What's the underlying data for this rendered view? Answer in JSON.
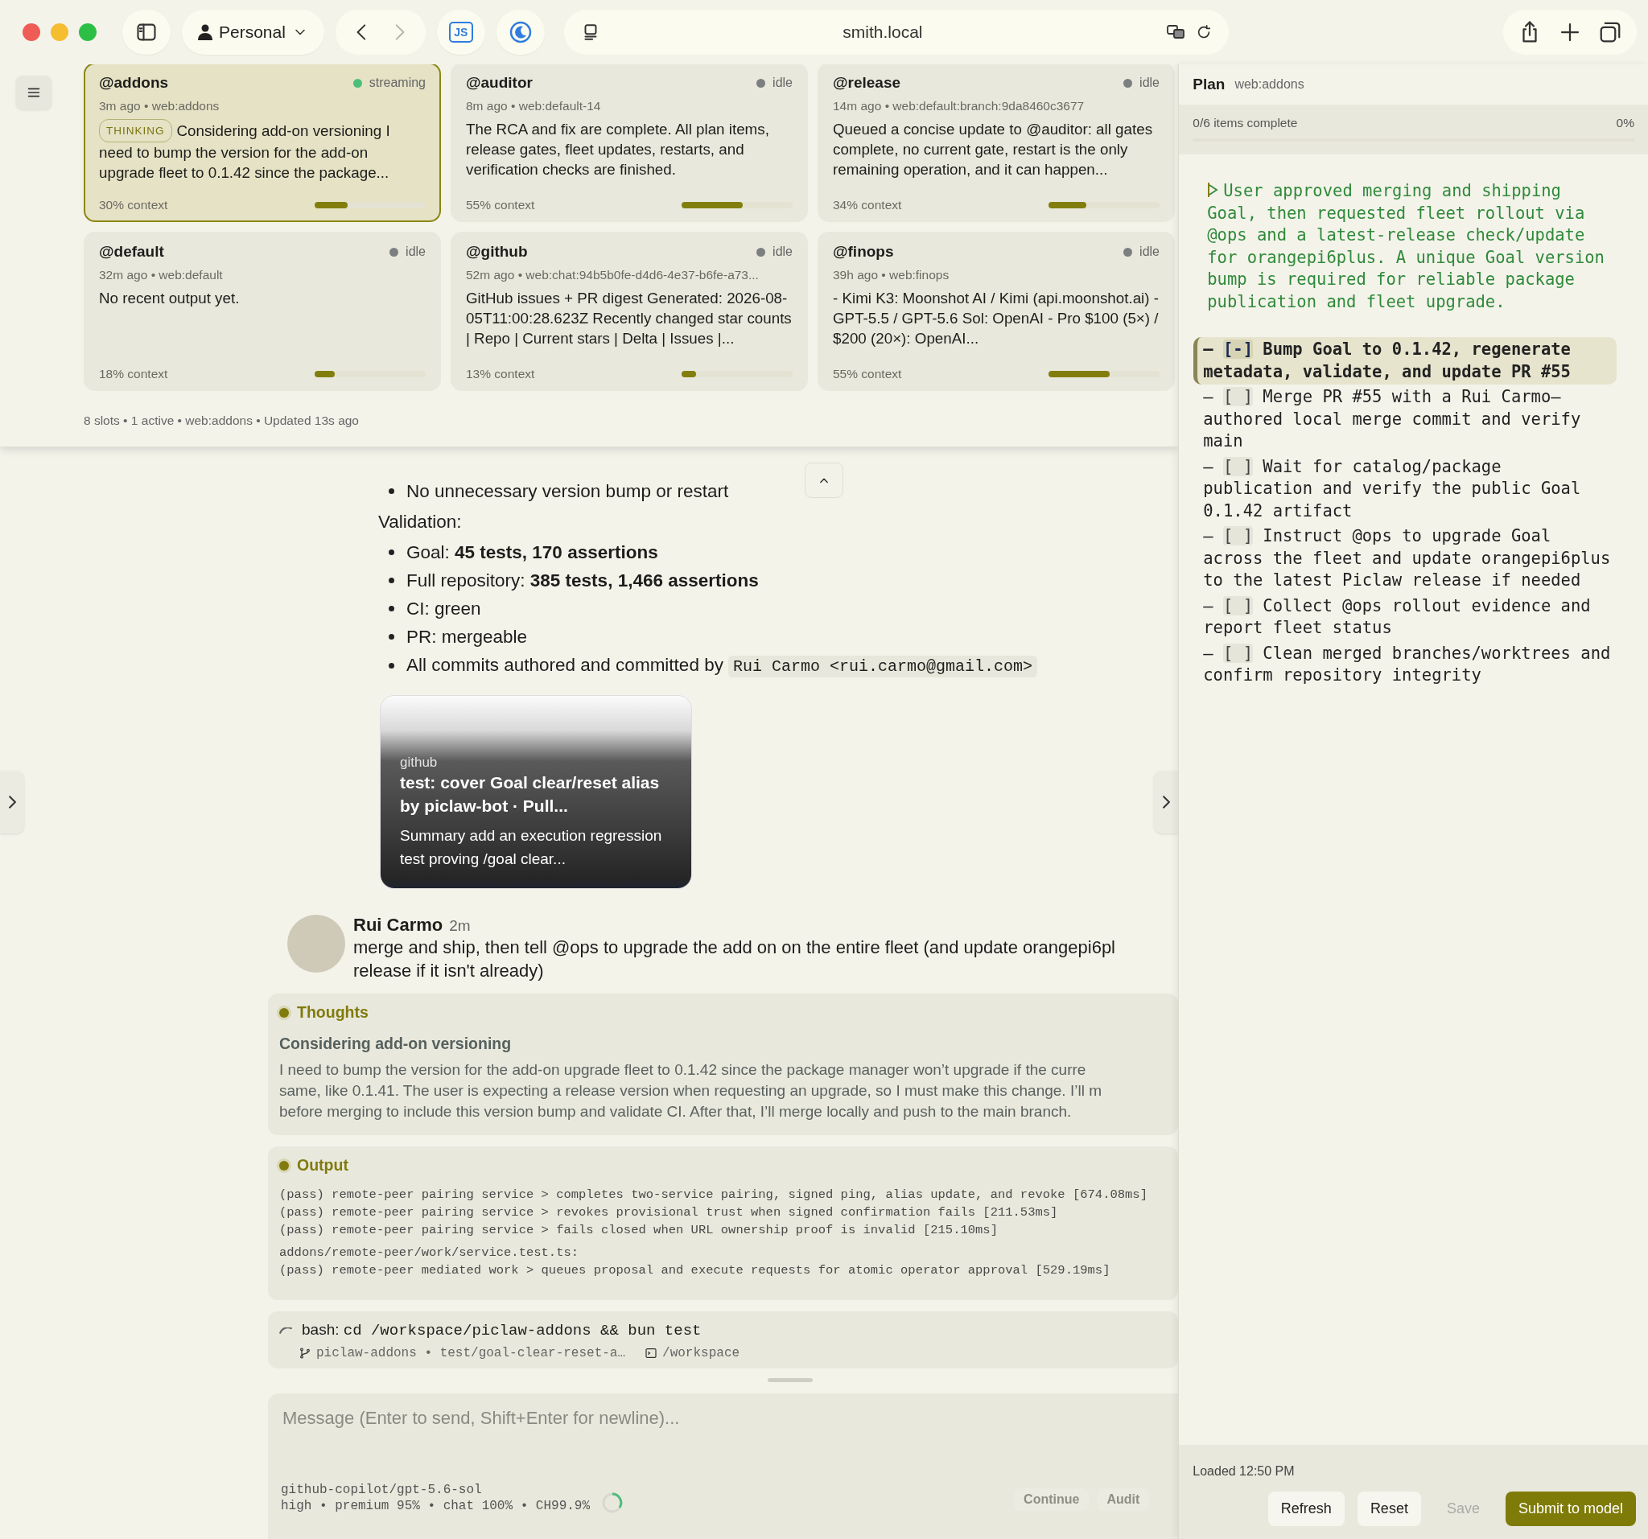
{
  "toolbar": {
    "profile": "Personal",
    "address": "smith.local",
    "forward_disabled": true,
    "extension_label": "JS"
  },
  "sessions": {
    "cards": [
      {
        "name": "@addons",
        "status": "streaming",
        "color": "#4cbf7a",
        "meta": "3m ago • web:addons",
        "badge": "THINKING",
        "summary": "Considering add-on versioning I need to bump the version for the add-on upgrade fleet to 0.1.42 since the package...",
        "context": "30% context",
        "level": 0.3,
        "selected": true
      },
      {
        "name": "@auditor",
        "status": "idle",
        "color": "#7b7f80",
        "meta": "8m ago • web:default-14",
        "summary": "The RCA and fix are complete. All plan items, release gates, fleet updates, restarts, and verification checks are finished.",
        "context": "55% context",
        "level": 0.55,
        "selected": false
      },
      {
        "name": "@release",
        "status": "idle",
        "color": "#7b7f80",
        "meta": "14m ago • web:default:branch:9da8460c3677",
        "summary": "Queued a concise update to @auditor: all gates complete, no current gate, restart is the only remaining operation, and it can happen...",
        "context": "34% context",
        "level": 0.34,
        "selected": false
      },
      {
        "name": "@default",
        "status": "idle",
        "color": "#7b7f80",
        "meta": "32m ago • web:default",
        "summary": "No recent output yet.",
        "context": "18% context",
        "level": 0.18,
        "selected": false
      },
      {
        "name": "@github",
        "status": "idle",
        "color": "#7b7f80",
        "meta": "52m ago • web:chat:94b5b0fe-d4d6-4e37-b6fe-a73...",
        "summary": "GitHub issues + PR digest Generated: 2026-08-05T11:00:28.623Z Recently changed star counts | Repo | Current stars | Delta | Issues |...",
        "context": "13% context",
        "level": 0.13,
        "selected": false
      },
      {
        "name": "@finops",
        "status": "idle",
        "color": "#7b7f80",
        "meta": "39h ago • web:finops",
        "summary": "- Kimi K3: Moonshot AI / Kimi (api.moonshot.ai) - GPT-5.5 / GPT-5.6 Sol: OpenAI - Pro $100 (5×) / $200 (20×): OpenAI...",
        "context": "55% context",
        "level": 0.55,
        "selected": false
      }
    ],
    "footer": "8 slots • 1 active • web:addons • Updated 13s ago"
  },
  "chat": {
    "bullets_top": [
      "No unnecessary version bump or restart"
    ],
    "heading": "Validation:",
    "bullets": [
      {
        "text": "Goal: **45 tests, 170 assertions**"
      },
      {
        "text": "Full repository: **385 tests, 1,466 assertions**"
      },
      {
        "text": "CI: green"
      },
      {
        "text": "PR: mergeable"
      },
      {
        "text": "All commits authored and committed by",
        "code": "Rui Carmo <rui.carmo@gmail.com>"
      }
    ],
    "link_preview": {
      "source": "github",
      "title": "test: cover Goal clear/reset alias by piclaw-bot · Pull...",
      "summary": "Summary add an execution regression test proving /goal clear..."
    },
    "message": {
      "author": "Rui Carmo",
      "time": "2m",
      "lines": [
        "merge and ship, then tell @ops to upgrade the add on on the entire fleet (and update orangepi6pl",
        "release if it isn't already)"
      ]
    },
    "thoughts": {
      "label": "Thoughts",
      "title": "Considering add-on versioning",
      "lines": [
        "I need to bump the version for the add-on upgrade fleet to 0.1.42 since the package manager won’t upgrade if the curre",
        "same, like 0.1.41. The user is expecting a release version when requesting an upgrade, so I must make this change. I’ll m",
        "before merging to include this version bump and validate CI. After that, I’ll merge locally and push to the main branch."
      ]
    },
    "output": {
      "label": "Output",
      "lines": [
        "(pass) remote-peer pairing service > completes two-service pairing, signed ping, alias update, and revoke [674.08ms]",
        "(pass) remote-peer pairing service > revokes provisional trust when signed confirmation fails [211.53ms]",
        "(pass) remote-peer pairing service > fails closed when URL ownership proof is invalid [215.10ms]",
        "addons/remote-peer/work/service.test.ts:",
        "(pass) remote-peer mediated work > queues proposal and execute requests for atomic operator approval [529.19ms]"
      ]
    },
    "tool_call": {
      "prefix": "bash:",
      "command": "cd /workspace/piclaw-addons && bun test",
      "branch": "piclaw-addons • test/goal-clear-reset-a…",
      "cwd": "/workspace"
    }
  },
  "composer": {
    "placeholder": "Message (Enter to send, Shift+Enter for newline)...",
    "model": "github-copilot/gpt-5.6-sol",
    "stats": "high • premium 95% • chat 100% • CH99.9%",
    "buttons": [
      {
        "label": "Continue",
        "disabled": true
      },
      {
        "label": "Audit",
        "disabled": true
      }
    ]
  },
  "plan": {
    "title": "Plan",
    "scope": "web:addons",
    "progress": "0/6 items complete",
    "percent": "0%",
    "level": 0,
    "note": "User approved merging and shipping Goal, then requested fleet rollout via @ops and a latest-release check/update for orangepi6plus. A unique Goal version bump is required for reliable package publication and fleet upgrade.",
    "items": [
      {
        "dash": "–",
        "box": "[-]",
        "text": "Bump Goal to 0.1.42, regenerate metadata, validate, and update PR #55",
        "current": true
      },
      {
        "dash": "–",
        "box": "[ ]",
        "text": "Merge PR #55 with a Rui Carmo–authored local merge commit and verify main",
        "current": false
      },
      {
        "dash": "–",
        "box": "[ ]",
        "text": "Wait for catalog/package publication and verify the public Goal 0.1.42 artifact",
        "current": false
      },
      {
        "dash": "–",
        "box": "[ ]",
        "text": "Instruct @ops to upgrade Goal across the fleet and update orangepi6plus to the latest Piclaw release if needed",
        "current": false
      },
      {
        "dash": "–",
        "box": "[ ]",
        "text": "Collect @ops rollout evidence and report fleet status",
        "current": false
      },
      {
        "dash": "–",
        "box": "[ ]",
        "text": "Clean merged branches/worktrees and confirm repository integrity",
        "current": false
      }
    ],
    "loaded": "Loaded 12:50 PM",
    "buttons": [
      {
        "label": "Refresh",
        "kind": "default",
        "disabled": false
      },
      {
        "label": "Reset",
        "kind": "default",
        "disabled": false
      },
      {
        "label": "Save",
        "kind": "default",
        "disabled": true
      },
      {
        "label": "Submit to model",
        "kind": "primary",
        "disabled": false
      }
    ]
  }
}
